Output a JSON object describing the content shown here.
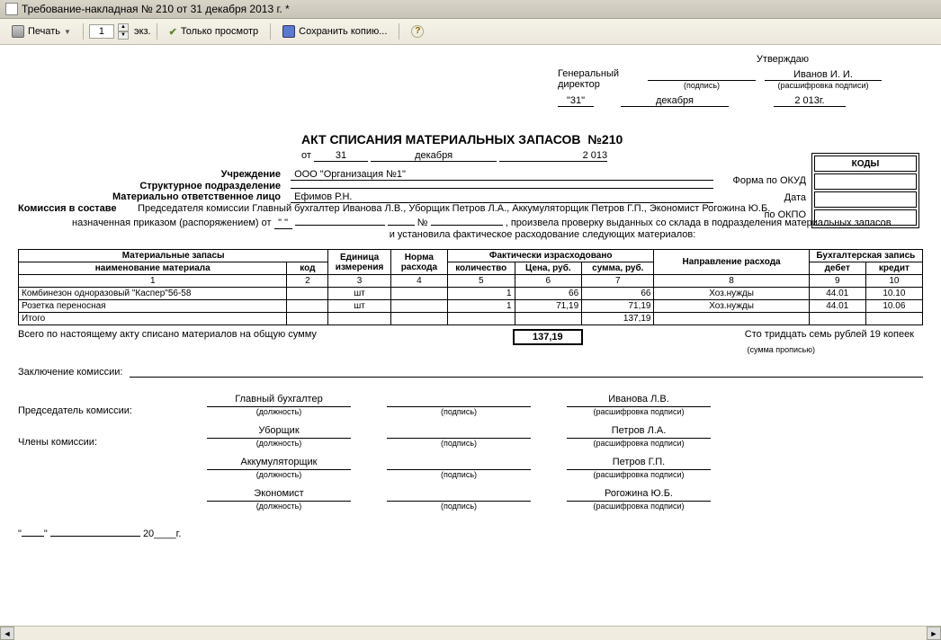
{
  "window": {
    "title": "Требование-накладная № 210 от 31 декабря 2013 г. *"
  },
  "toolbar": {
    "print": "Печать",
    "ekz_value": "1",
    "ekz_label": "экз.",
    "view_only": "Только просмотр",
    "save_copy": "Сохранить копию...",
    "help": "?"
  },
  "approve": {
    "utverzhdayu": "Утверждаю",
    "position_label": "Генеральный\nдиректор",
    "podpis": "(подпись)",
    "name": "Иванов И. И.",
    "rasshifrovka": "(расшифровка подписи)",
    "day": "\"31\"",
    "month": "декабря",
    "year": "2 013г."
  },
  "codes": {
    "header": "КОДЫ",
    "okud_label": "Форма по ОКУД",
    "date_label": "Дата",
    "okpo_label": "по ОКПО"
  },
  "title": "АКТ СПИСАНИЯ МАТЕРИАЛЬНЫХ ЗАПАСОВ",
  "title_no": "№210",
  "date": {
    "ot": "от",
    "day": "31",
    "month": "декабря",
    "year": "2 013"
  },
  "org": {
    "uchrezhdenie_label": "Учреждение",
    "uchrezhdenie": "ООО \"Организация №1\"",
    "podrazd_label": "Структурное подразделение",
    "mol_label": "Материально ответственное лицо",
    "mol": "Ефимов Р.Н.",
    "commission_label": "Комиссия в составе",
    "commission": "Председателя комиссии Главный бухгалтер Иванова Л.В., Уборщик Петров Л.А., Аккумуляторщик Петров Г.П., Экономист Рогожина Ю.Б.",
    "order_text": "назначенная приказом (распоряжением) от",
    "order_no": "№",
    "order_tail1": ", произвела проверку выданных со склада в подразделения материальных запасов",
    "order_tail2": "и установила фактическое расходование следующих материалов:"
  },
  "table": {
    "h_matzap": "Материальные запасы",
    "h_naim": "наименование материала",
    "h_kod": "код",
    "h_unit": "Единица измерения",
    "h_norma": "Норма расхода",
    "h_fact": "Фактически израсходовано",
    "h_qty": "количество",
    "h_price": "Цена, руб.",
    "h_sum": "сумма, руб.",
    "h_dir": "Направление расхода",
    "h_acct": "Бухгалтерская запись",
    "h_debet": "дебет",
    "h_kredit": "кредит",
    "cols": [
      "1",
      "2",
      "3",
      "4",
      "5",
      "6",
      "7",
      "8",
      "9",
      "10"
    ],
    "rows": [
      {
        "name": "Комбинезон одноразовый \"Каспер\"56-58",
        "kod": "",
        "unit": "шт",
        "norma": "",
        "qty": "1",
        "price": "66",
        "sum": "66",
        "dir": "Хоз.нужды",
        "debet": "44.01",
        "kredit": "10.10"
      },
      {
        "name": "Розетка переносная",
        "kod": "",
        "unit": "шт",
        "norma": "",
        "qty": "1",
        "price": "71,19",
        "sum": "71,19",
        "dir": "Хоз.нужды",
        "debet": "44.01",
        "kredit": "10.06"
      }
    ],
    "itogo": "Итого",
    "itogo_sum": "137,19"
  },
  "summary": {
    "text": "Всего по настоящему акту списано материалов на общую сумму",
    "total": "137,19",
    "words": "Сто тридцать семь рублей 19 копеек",
    "words_cap": "(сумма прописью)"
  },
  "conclusion": {
    "label": "Заключение комиссии:"
  },
  "signatures": {
    "chairman_label": "Председатель комиссии:",
    "members_label": "Члены комиссии:",
    "dolzhnost": "(должность)",
    "podpis": "(подпись)",
    "rasshifrovka": "(расшифровка подписи)",
    "rows": [
      {
        "pos": "Главный бухгалтер",
        "name": "Иванова Л.В."
      },
      {
        "pos": "Уборщик",
        "name": "Петров Л.А."
      },
      {
        "pos": "Аккумуляторщик",
        "name": "Петров Г.П."
      },
      {
        "pos": "Экономист",
        "name": "Рогожина Ю.Б."
      }
    ]
  },
  "footer_date": {
    "y": "20____г."
  }
}
